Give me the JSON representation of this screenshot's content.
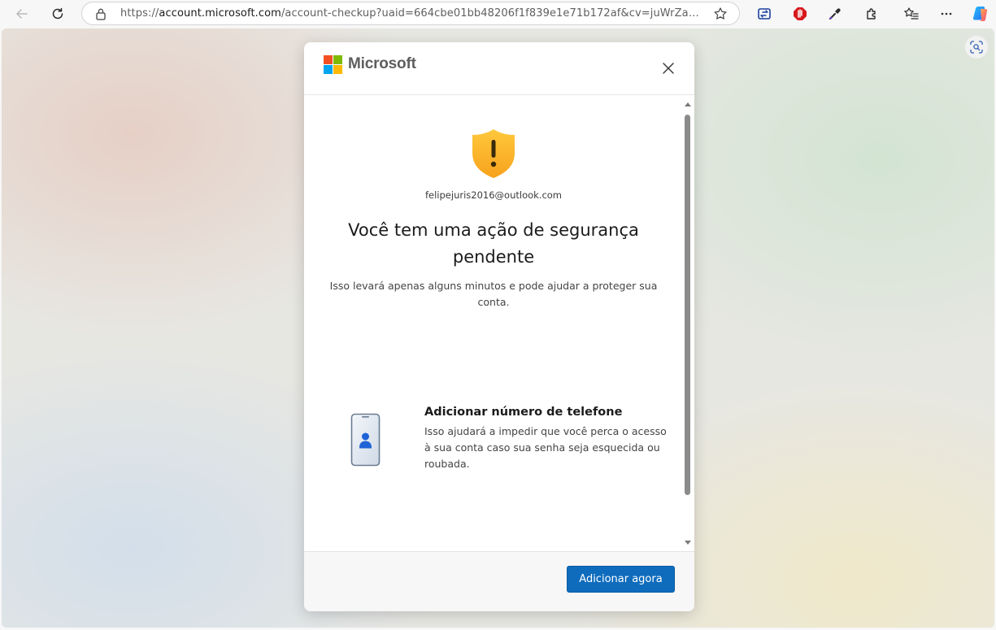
{
  "browser": {
    "url_scheme": "https://",
    "url_host": "account.microsoft.com",
    "url_path": "/account-checkup?uaid=664cbe01bb48206f1f839e1e71b172af&cv=juWrZa3g%2F0i...",
    "icons": [
      "back-icon",
      "refresh-icon",
      "lock-icon",
      "favorite-star-icon",
      "split-screen-icon",
      "adblock-icon",
      "eyedropper-icon",
      "extensions-icon",
      "favorites-icon",
      "more-icon",
      "copilot-icon",
      "visual-search-icon"
    ]
  },
  "dialog": {
    "brand": "Microsoft",
    "email": "felipejuris2016@outlook.com",
    "heading": "Você tem uma ação de segurança pendente",
    "subtitle": "Isso levará apenas alguns minutos e pode ajudar a proteger sua conta.",
    "task": {
      "title": "Adicionar número de telefone",
      "description": "Isso ajudará a impedir que você perca o acesso à sua conta caso sua senha seja esquecida ou roubada."
    },
    "primary_button": "Adicionar agora"
  },
  "colors": {
    "ms_red": "#f25022",
    "ms_green": "#7fba00",
    "ms_blue": "#00a4ef",
    "ms_yellow": "#ffb900",
    "primary": "#0f6cbd",
    "shield_top": "#ffc83d",
    "shield_bottom": "#f7a21c"
  }
}
